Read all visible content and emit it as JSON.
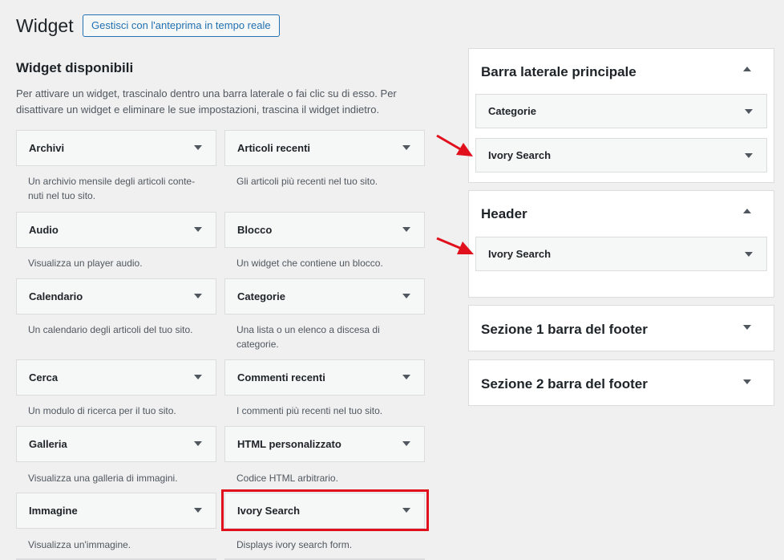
{
  "header": {
    "title": "Widget",
    "preview_button": "Gestisci con l'anteprima in tempo reale"
  },
  "available": {
    "title": "Widget disponibili",
    "description": "Per attivare un widget, trascinalo dentro una barra laterale o fai clic su di esso. Per disattivare un widget e eliminare le sue impostazioni, trascina il widget indietro.",
    "widgets": [
      {
        "label": "Archivi",
        "desc": "Un archivio mensile degli articoli conte-nuti nel tuo sito."
      },
      {
        "label": "Articoli recenti",
        "desc": "Gli articoli più recenti nel tuo sito."
      },
      {
        "label": "Audio",
        "desc": "Visualizza un player audio."
      },
      {
        "label": "Blocco",
        "desc": "Un widget che contiene un blocco."
      },
      {
        "label": "Calendario",
        "desc": "Un calendario degli articoli del tuo sito."
      },
      {
        "label": "Categorie",
        "desc": "Una lista o un elenco a discesa di categorie."
      },
      {
        "label": "Cerca",
        "desc": "Un modulo di ricerca per il tuo sito."
      },
      {
        "label": "Commenti recenti",
        "desc": "I commenti più recenti nel tuo sito."
      },
      {
        "label": "Galleria",
        "desc": "Visualizza una galleria di immagini."
      },
      {
        "label": "HTML personalizzato",
        "desc": "Codice HTML arbitrario."
      },
      {
        "label": "Immagine",
        "desc": "Visualizza un'immagine."
      },
      {
        "label": "Ivory Search",
        "desc": "Displays ivory search form."
      }
    ]
  },
  "sidebars": [
    {
      "title": "Barra laterale principale",
      "widgets": [
        "Categorie",
        "Ivory Search"
      ]
    },
    {
      "title": "Header",
      "widgets": [
        "Ivory Search"
      ]
    },
    {
      "title": "Sezione 1 barra del footer",
      "widgets": []
    },
    {
      "title": "Sezione 2 barra del footer",
      "widgets": []
    }
  ],
  "icons": {
    "expand": "chevron-down-icon",
    "collapse": "chevron-up-icon",
    "annotation": "red-arrow-icon"
  },
  "colors": {
    "accent": "#2271b1",
    "highlight": "#e0101c",
    "background": "#f0f0f1"
  }
}
